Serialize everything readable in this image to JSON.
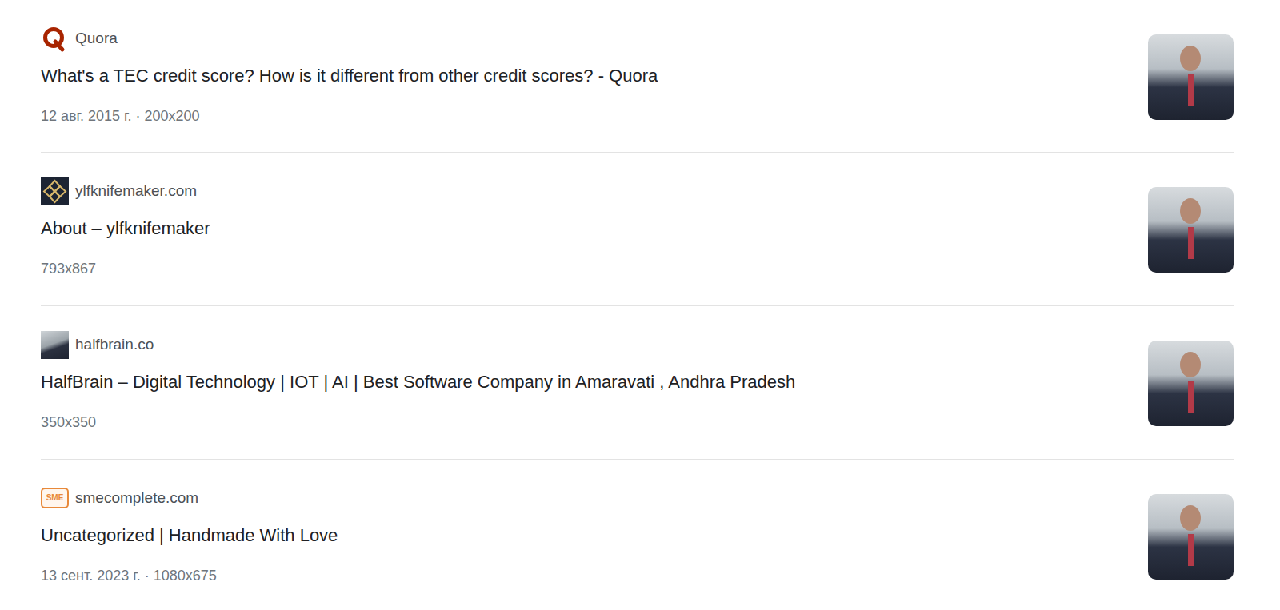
{
  "results": [
    {
      "source": "Quora",
      "title": "What's a TEC credit score? How is it different from other credit scores? - Quora",
      "meta": "12 авг. 2015 г. · 200x200",
      "kind": "quora"
    },
    {
      "source": "ylfknifemaker.com",
      "title": "About – ylfknifemaker",
      "meta": "793x867",
      "kind": "knife"
    },
    {
      "source": "halfbrain.co",
      "title": "HalfBrain – Digital Technology | IOT | AI | Best Software Company in Amaravati , Andhra Pradesh",
      "meta": "350x350",
      "kind": "photo"
    },
    {
      "source": "smecomplete.com",
      "title": "Uncategorized | Handmade With Love",
      "meta": "13 сент. 2023 г. · 1080x675",
      "kind": "sme",
      "favicon_text": "SME"
    }
  ]
}
